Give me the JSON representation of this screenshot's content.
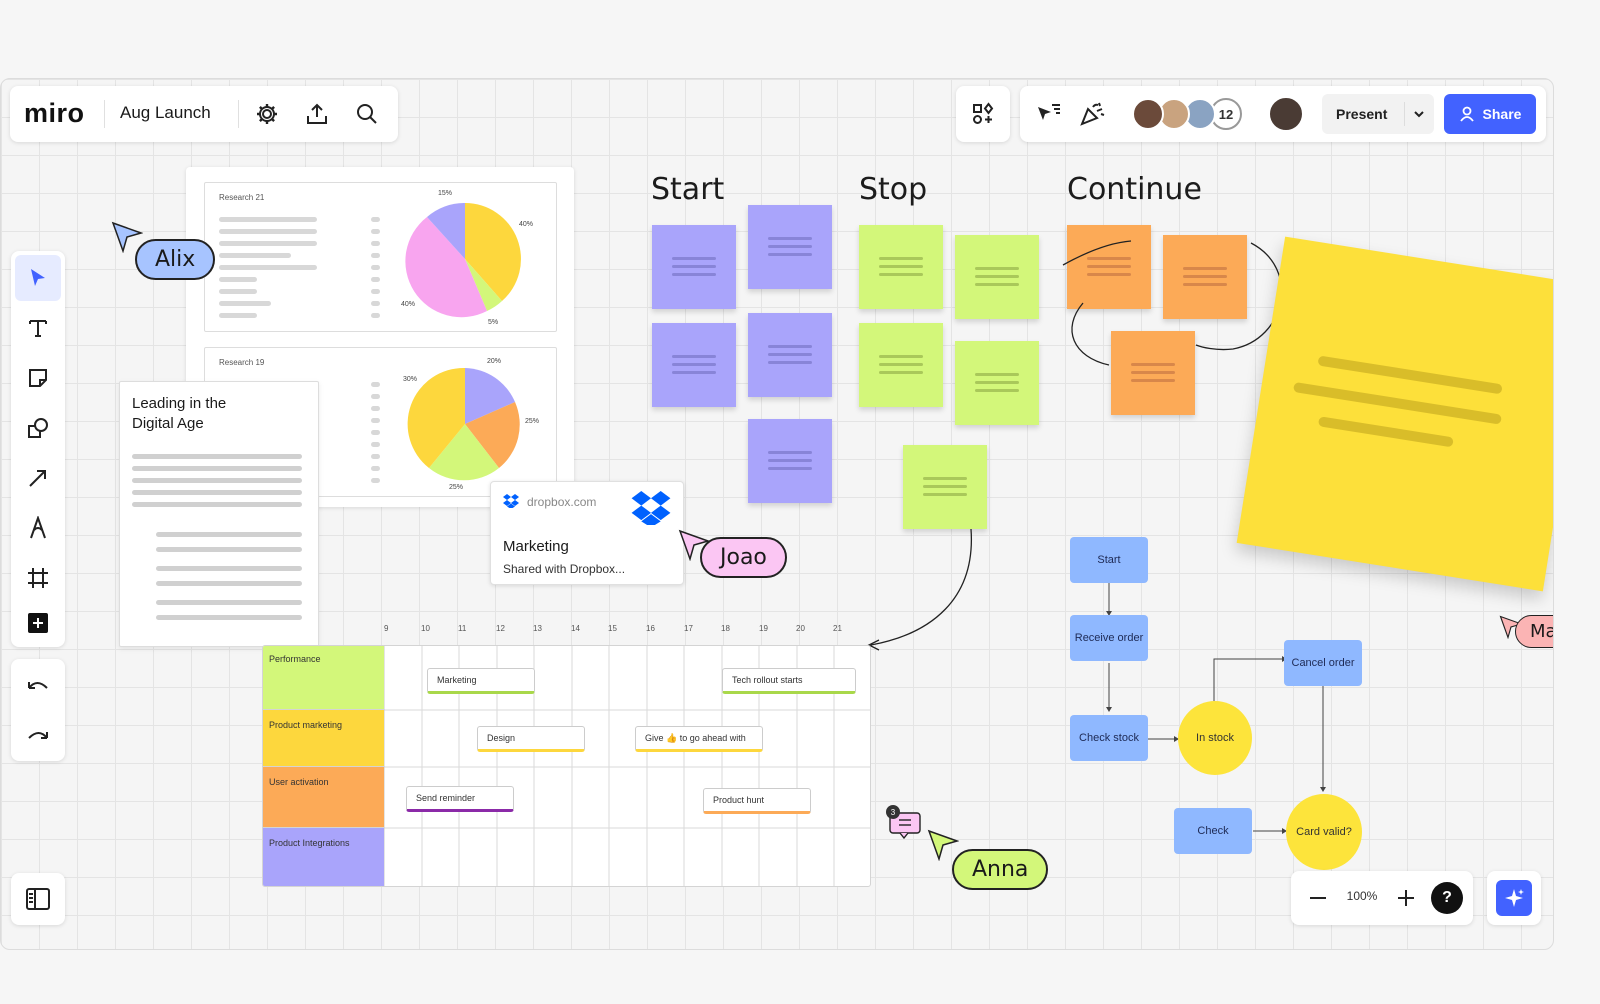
{
  "app": {
    "logo": "miro",
    "board_title": "Aug Launch"
  },
  "toolbar": {
    "present_label": "Present",
    "share_label": "Share",
    "collaborator_count": "12"
  },
  "retro": {
    "headings": [
      "Start",
      "Stop",
      "Continue"
    ]
  },
  "research": {
    "card1_title": "Research 21",
    "card1_pcts": [
      "15%",
      "40%",
      "40%",
      "5%"
    ],
    "card2_title": "Research 19",
    "card2_pcts": [
      "20%",
      "30%",
      "25%",
      "25%"
    ]
  },
  "doc": {
    "title": "Leading in the Digital Age"
  },
  "dropbox": {
    "domain": "dropbox.com",
    "title": "Marketing",
    "subtitle": "Shared with Dropbox..."
  },
  "cursors": {
    "alix": "Alix",
    "joao": "Joao",
    "anna": "Anna",
    "maria": "Maria"
  },
  "gantt": {
    "days": [
      "9",
      "10",
      "11",
      "12",
      "13",
      "14",
      "15",
      "16",
      "17",
      "18",
      "19",
      "20",
      "21"
    ],
    "rows": [
      "Performance",
      "Product marketing",
      "User activation",
      "Product Integrations"
    ],
    "tasks": {
      "marketing": "Marketing",
      "tech": "Tech rollout starts",
      "design": "Design",
      "give": "Give 👍 to go ahead with",
      "reminder": "Send reminder",
      "hunt": "Product hunt"
    }
  },
  "comment": {
    "count": "3"
  },
  "flowchart": {
    "start": "Start",
    "receive": "Receive order",
    "check_stock": "Check stock",
    "in_stock": "In stock",
    "cancel": "Cancel order",
    "check": "Check",
    "card_valid": "Card valid?"
  },
  "zoom": {
    "level": "100%",
    "help": "?"
  },
  "colors": {
    "purple": "#a9a4fb",
    "green": "#d3f77a",
    "orange": "#fcaa57",
    "yellow": "#fde03a",
    "blue": "#4262ff",
    "fc_blue": "#8fb8ff"
  }
}
